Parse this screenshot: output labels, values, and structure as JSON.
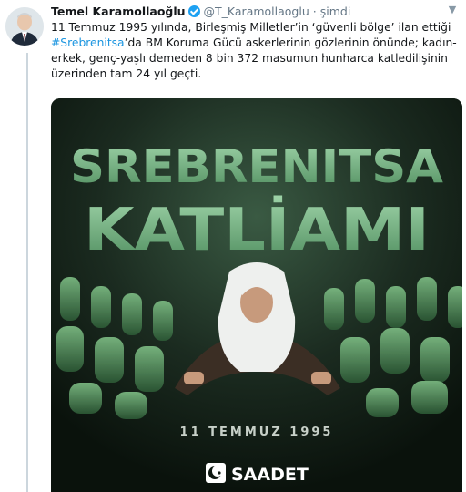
{
  "tweet": {
    "author_name": "Temel Karamollaoğlu",
    "author_handle": "@T_Karamollaoglu",
    "separator": "·",
    "timestamp": "şimdi",
    "text_parts": {
      "before": "11 Temmuz 1995 yılında, Birleşmiş Milletler’in ‘güvenli bölge’ ilan ettiği ",
      "hashtag": "#Srebrenitsa",
      "after": "’da BM Koruma Gücü askerlerinin gözlerinin önünde; kadın-erkek, genç-yaşlı demeden 8 bin 372 masumun hunharca katledilişinin üzerinden tam 24 yıl geçti."
    }
  },
  "poster": {
    "title_line1": "SREBRENITSA",
    "title_line2": "KATLİAMI",
    "date": "11 TEMMUZ 1995",
    "brand": "SAADET"
  },
  "icons": {
    "caret": "chevron-down-icon",
    "verified": "verified-badge-icon",
    "logo": "saadet-crescent-logo"
  },
  "colors": {
    "hashtag": "#1b95e0",
    "verified": "#1da1f2",
    "poster_title": "#6fb27e",
    "poster_bg": "#0e1811"
  }
}
